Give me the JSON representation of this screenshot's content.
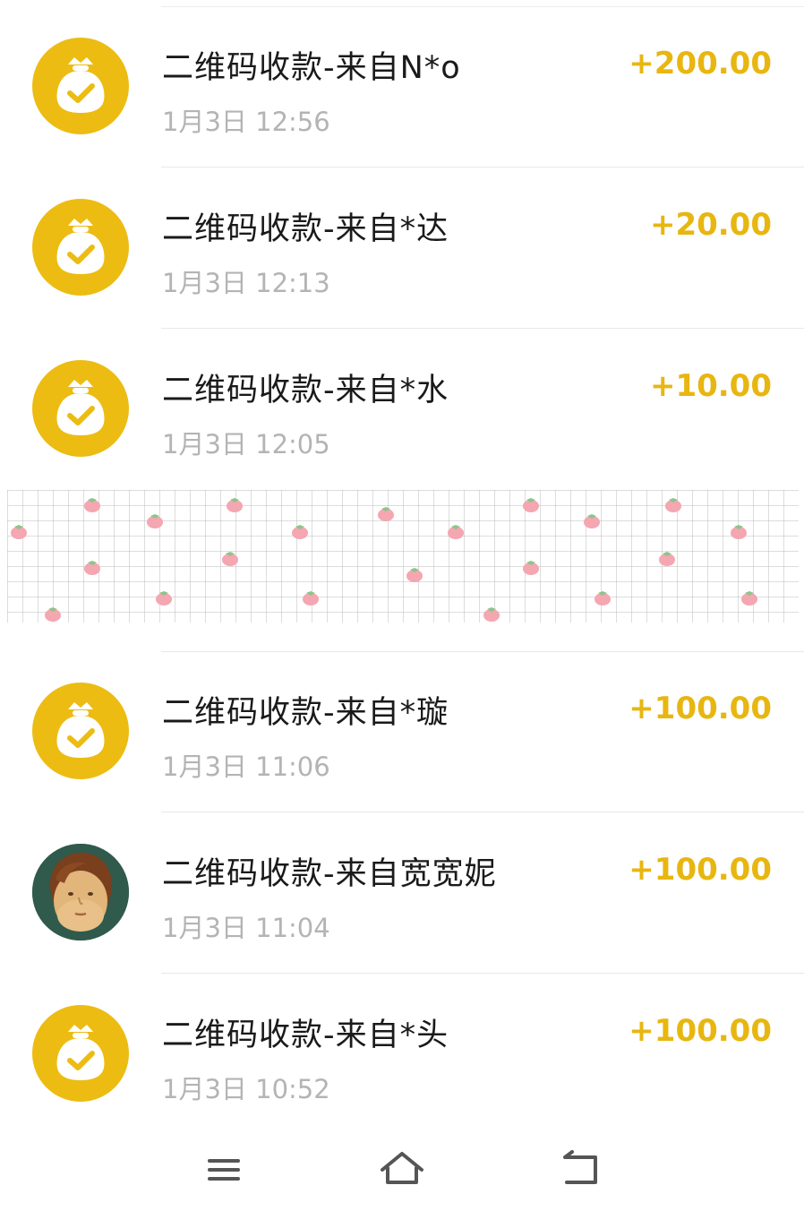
{
  "transactions": [
    {
      "title": "二维码收款-来自N*o",
      "time": "1月3日 12:56",
      "amount": "+200.00",
      "avatar": "money-bag-icon"
    },
    {
      "title": "二维码收款-来自*达",
      "time": "1月3日 12:13",
      "amount": "+20.00",
      "avatar": "money-bag-icon"
    },
    {
      "title": "二维码收款-来自*水",
      "time": "1月3日 12:05",
      "amount": "+10.00",
      "avatar": "money-bag-icon"
    },
    {
      "title": "二维码收款-来自*璇",
      "time": "1月3日 11:06",
      "amount": "+100.00",
      "avatar": "money-bag-icon"
    },
    {
      "title": "二维码收款-来自宽宽妮",
      "time": "1月3日 11:04",
      "amount": "+100.00",
      "avatar": "user-photo"
    },
    {
      "title": "二维码收款-来自*头",
      "time": "1月3日 10:52",
      "amount": "+100.00",
      "avatar": "money-bag-icon"
    }
  ],
  "colors": {
    "accent": "#ecbc12",
    "amount": "#e8b610",
    "time": "#b4b4b4",
    "title": "#1a1a1a"
  },
  "nav_bar": {
    "icons": [
      "menu-icon",
      "home-icon",
      "back-icon"
    ]
  }
}
